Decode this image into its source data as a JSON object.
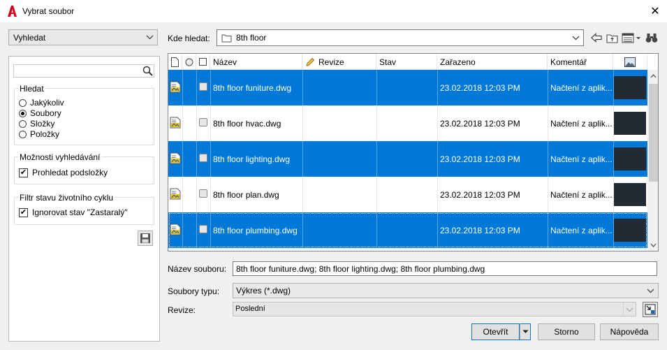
{
  "window": {
    "title": "Vybrat soubor",
    "close_glyph": "✕",
    "brand_color": "#d0021b"
  },
  "left": {
    "search_mode": "Vyhledat",
    "search_placeholder": "",
    "group_find": {
      "label": "Hledat",
      "options": [
        "Jakýkoliv",
        "Soubory",
        "Složky",
        "Položky"
      ],
      "selected": "Soubory"
    },
    "group_options": {
      "label": "Možnosti vyhledávání",
      "checkbox_label": "Prohledat podsložky",
      "checked": true
    },
    "group_lifecycle": {
      "label": "Filtr stavu životního cyklu",
      "checkbox_label": "Ignorovat stav \"Zastaralý\"",
      "checked": true
    }
  },
  "location": {
    "label": "Kde hledat:",
    "value": "8th floor"
  },
  "table": {
    "columns": [
      "Název",
      "Revize",
      "Stav",
      "Zařazeno",
      "Komentář"
    ],
    "selection_color": "#0078d7",
    "rows": [
      {
        "name": "8th floor funiture.dwg",
        "revision": "",
        "state": "",
        "date": "23.02.2018 12:03 PM",
        "comment": "Načtení z aplik...",
        "selected": true
      },
      {
        "name": "8th floor hvac.dwg",
        "revision": "",
        "state": "",
        "date": "23.02.2018 12:03 PM",
        "comment": "Načtení z aplik...",
        "selected": false
      },
      {
        "name": "8th floor lighting.dwg",
        "revision": "",
        "state": "",
        "date": "23.02.2018 12:03 PM",
        "comment": "Načtení z aplik...",
        "selected": true
      },
      {
        "name": "8th floor plan.dwg",
        "revision": "",
        "state": "",
        "date": "23.02.2018 12:03 PM",
        "comment": "Načtení z aplik...",
        "selected": false
      },
      {
        "name": "8th floor plumbing.dwg",
        "revision": "",
        "state": "",
        "date": "23.02.2018 12:03 PM",
        "comment": "Načtení z aplik...",
        "selected": true
      }
    ]
  },
  "fields": {
    "filename_label": "Název souboru:",
    "filename_value": "8th floor funiture.dwg; 8th floor lighting.dwg; 8th floor plumbing.dwg",
    "filetype_label": "Soubory typu:",
    "filetype_value": "Výkres (*.dwg)",
    "revision_label": "Revize:",
    "revision_value": "Poslední"
  },
  "buttons": {
    "open": "Otevřít",
    "cancel": "Storno",
    "help": "Nápověda"
  }
}
